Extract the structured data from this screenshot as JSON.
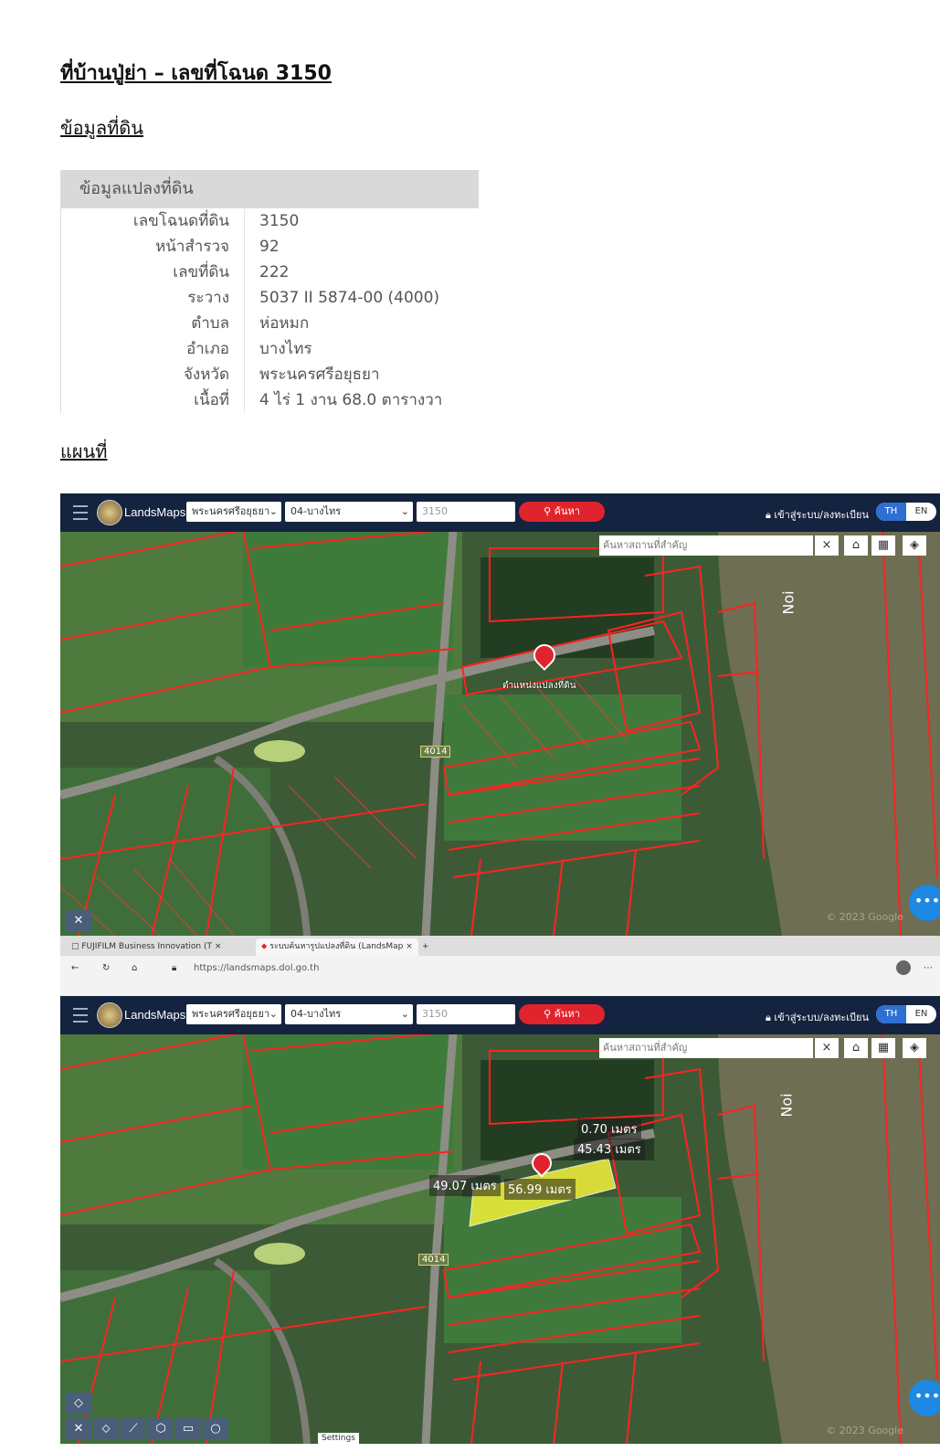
{
  "doc": {
    "title": "ที่บ้านปู่ย่า – เลขที่โฉนด 3150",
    "land_heading": "ข้อมูลที่ดิน",
    "map_heading": "แผนที่"
  },
  "land_info": {
    "header": "ข้อมูลแปลงที่ดิน",
    "rows": [
      {
        "label": "เลขโฉนดที่ดิน",
        "value": "3150"
      },
      {
        "label": "หน้าสำรวจ",
        "value": "92"
      },
      {
        "label": "เลขที่ดิน",
        "value": "222"
      },
      {
        "label": "ระวาง",
        "value": "5037 II 5874-00 (4000)"
      },
      {
        "label": "ตำบล",
        "value": "ห่อหมก"
      },
      {
        "label": "อำเภอ",
        "value": "บางไทร"
      },
      {
        "label": "จังหวัด",
        "value": "พระนครศรีอยุธยา"
      },
      {
        "label": "เนื้อที่",
        "value": "4 ไร่ 1 งาน 68.0 ตารางวา"
      }
    ]
  },
  "app": {
    "brand": "LandsMaps",
    "province": "พระนครศรีอยุธยา",
    "district": "04-บางไทร",
    "deed_no": "3150",
    "search_label": "ค้นหา",
    "login_label": "เข้าสู่ระบบ/ลงทะเบียน",
    "lang_th": "TH",
    "lang_en": "EN",
    "place_placeholder": "ค้นหาสถานที่สำคัญ",
    "close": "×",
    "fab": "•••",
    "colors": {
      "topbar": "#14233f",
      "search": "#e0242e",
      "parcel": "#ff2222",
      "highlight": "#f2f23a",
      "lang_active": "#2f6fd1"
    }
  },
  "map": {
    "river_label": "Noi",
    "road_label": "4014",
    "marker_label": "ตำแหน่งแปลงที่ดิน",
    "attribution": "© 2023 Google",
    "measurements": [
      "0.70 เมตร",
      "45.43 เมตร",
      "49.07 เมตร",
      "56.99 เมตร"
    ]
  },
  "browser": {
    "tab1": "FUJIFILM Business Innovation (T",
    "tab2": "ระบบค้นหารูปแปลงที่ดิน (LandsMap",
    "url": "https://landsmaps.dol.go.th",
    "settings": "Settings"
  }
}
